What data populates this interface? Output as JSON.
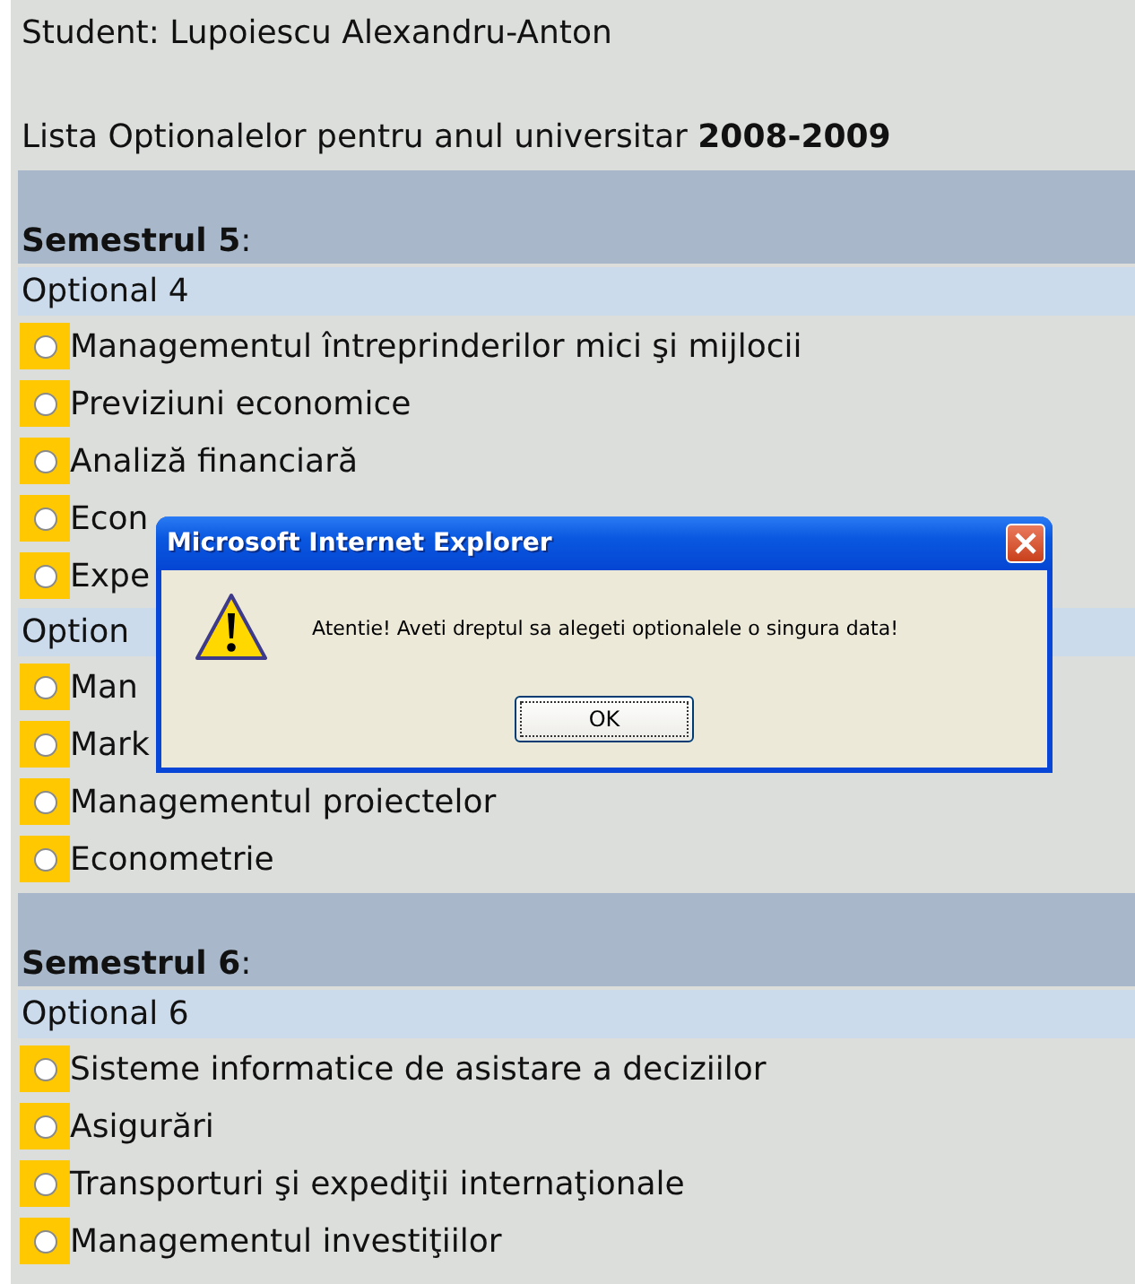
{
  "student_line": "Student: Lupoiescu Alexandru-Anton",
  "list_heading": "Lista Optionalelor pentru anul universitar **2008-2009**",
  "semesters": [
    {
      "title": "**Semestrul 5**:",
      "groups": [
        {
          "title": "Optional 4",
          "options": [
            {
              "label": "Managementul întreprinderilor mici şi mijlocii",
              "selected": false
            },
            {
              "label": "Previziuni economice",
              "selected": false
            },
            {
              "label": "Analiză financiară",
              "selected": false
            },
            {
              "label": "Econ",
              "selected": false
            },
            {
              "label": "Expe",
              "selected": false
            }
          ]
        },
        {
          "title": "Option",
          "options": [
            {
              "label": "Man",
              "selected": false
            },
            {
              "label": "Mark",
              "selected": false
            },
            {
              "label": "Managementul proiectelor",
              "selected": false
            },
            {
              "label": "Econometrie",
              "selected": false
            }
          ]
        }
      ]
    },
    {
      "title": "**Semestrul 6**:",
      "groups": [
        {
          "title": "Optional 6",
          "options": [
            {
              "label": "Sisteme informatice de asistare a deciziilor",
              "selected": false
            },
            {
              "label": "Asigurări",
              "selected": false
            },
            {
              "label": "Transporturi şi expediţii internaţionale",
              "selected": false
            },
            {
              "label": "Managementul investiţiilor",
              "selected": false
            }
          ]
        }
      ]
    }
  ],
  "dialog": {
    "title": "Microsoft Internet Explorer",
    "message": "Atentie! Aveti dreptul sa alegeti optionalele o singura data!",
    "button": "OK"
  }
}
